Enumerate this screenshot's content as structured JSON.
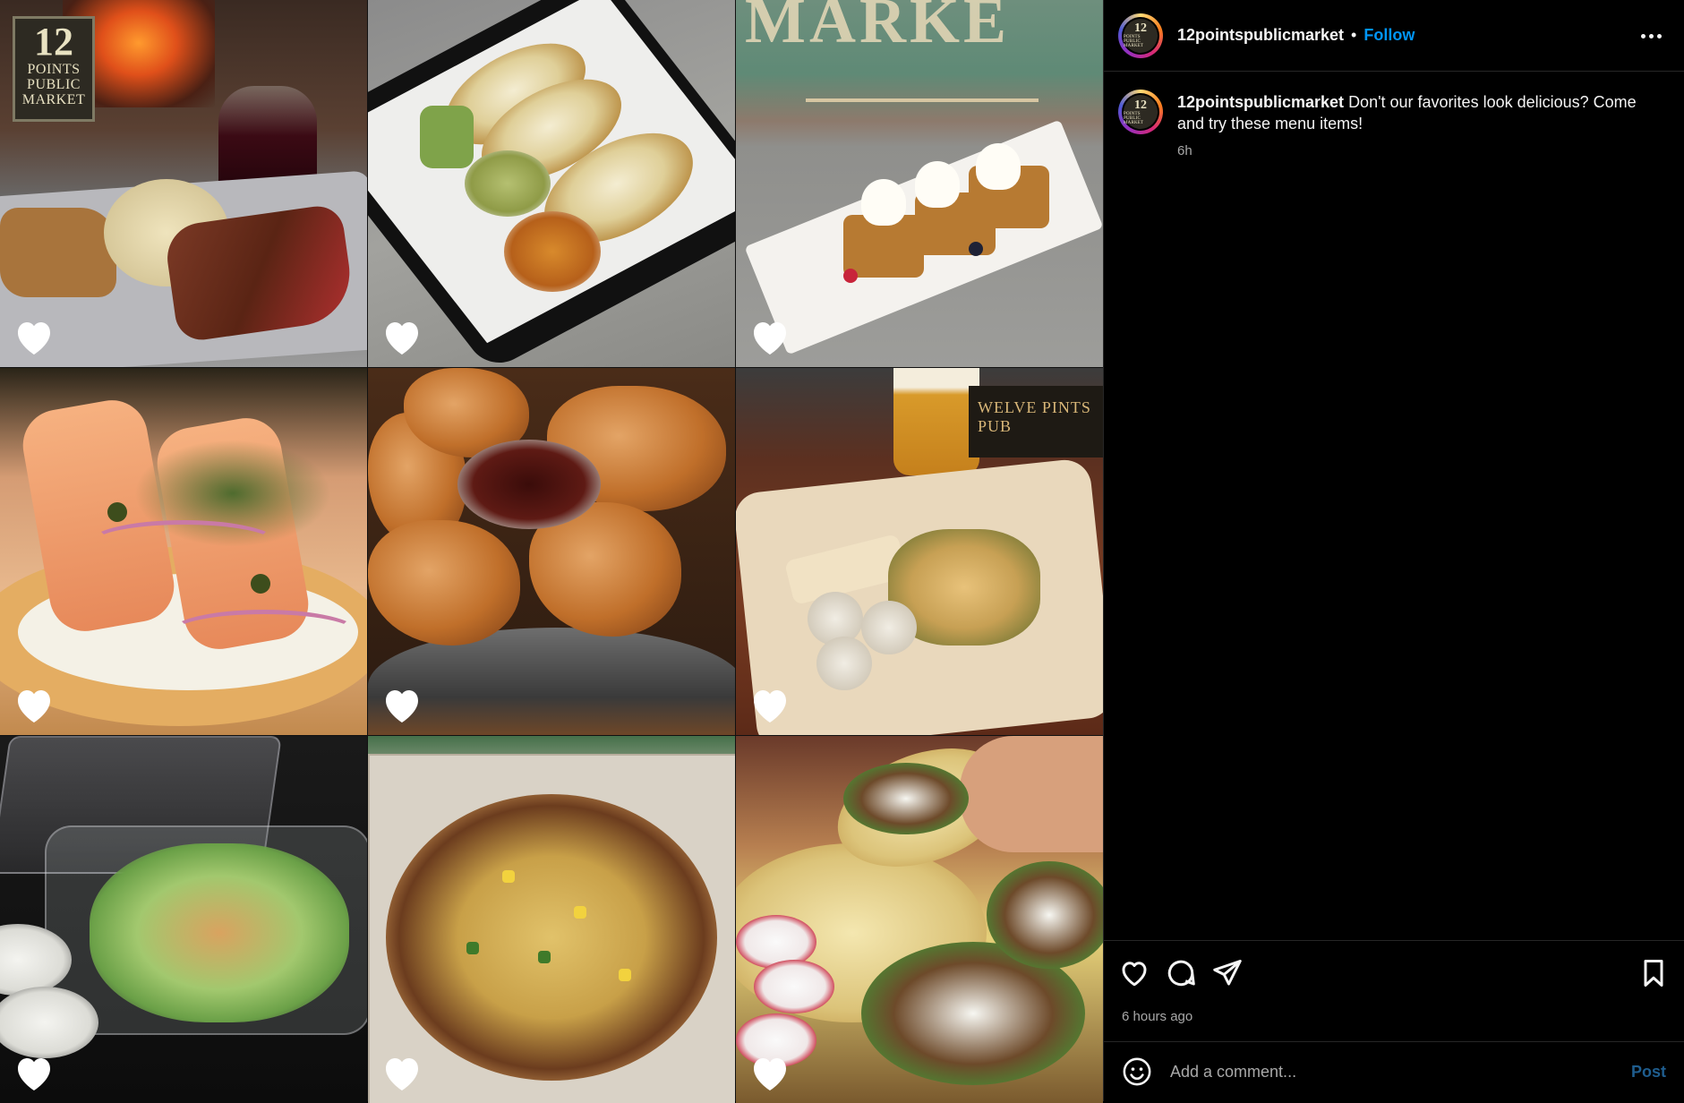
{
  "grid": {
    "photos": [
      {
        "label": "meatloaf-tray",
        "logo_number": "12",
        "logo_line1": "POINTS",
        "logo_line2": "PUBLIC",
        "logo_line3": "MARKET"
      },
      {
        "label": "tacos-basket"
      },
      {
        "label": "waffles-plate",
        "sign_text": "MARKE"
      },
      {
        "label": "lox-bagel"
      },
      {
        "label": "fried-chicken"
      },
      {
        "label": "pub-plate",
        "sign_text": "WELVE PINTS PUB"
      },
      {
        "label": "caesar-salad"
      },
      {
        "label": "pizza"
      },
      {
        "label": "street-tacos"
      }
    ],
    "heart_icon": "heart-icon",
    "heart_color": "#ffffff"
  },
  "post": {
    "username": "12pointspublicmarket",
    "separator": "•",
    "follow_label": "Follow",
    "follow_color": "#0095f6",
    "avatar_logo": {
      "number": "12",
      "text": "POINTS PUBLIC MARKET"
    },
    "caption": {
      "username": "12pointspublicmarket",
      "text": "Don't our favorites look delicious? Come and try these menu items!",
      "time": "6h"
    },
    "actions": {
      "like_icon": "heart-icon",
      "comment_icon": "comment-icon",
      "share_icon": "send-icon",
      "save_icon": "bookmark-icon",
      "timestamp": "6 hours ago"
    },
    "comment": {
      "emoji_icon": "smiley-icon",
      "placeholder": "Add a comment...",
      "post_label": "Post",
      "post_color": "#1f5d8e"
    },
    "more_icon": "more-options-icon"
  },
  "theme": {
    "background": "#000000",
    "text": "#f5f5f5",
    "muted": "#a8a8a8",
    "divider": "#262626"
  }
}
